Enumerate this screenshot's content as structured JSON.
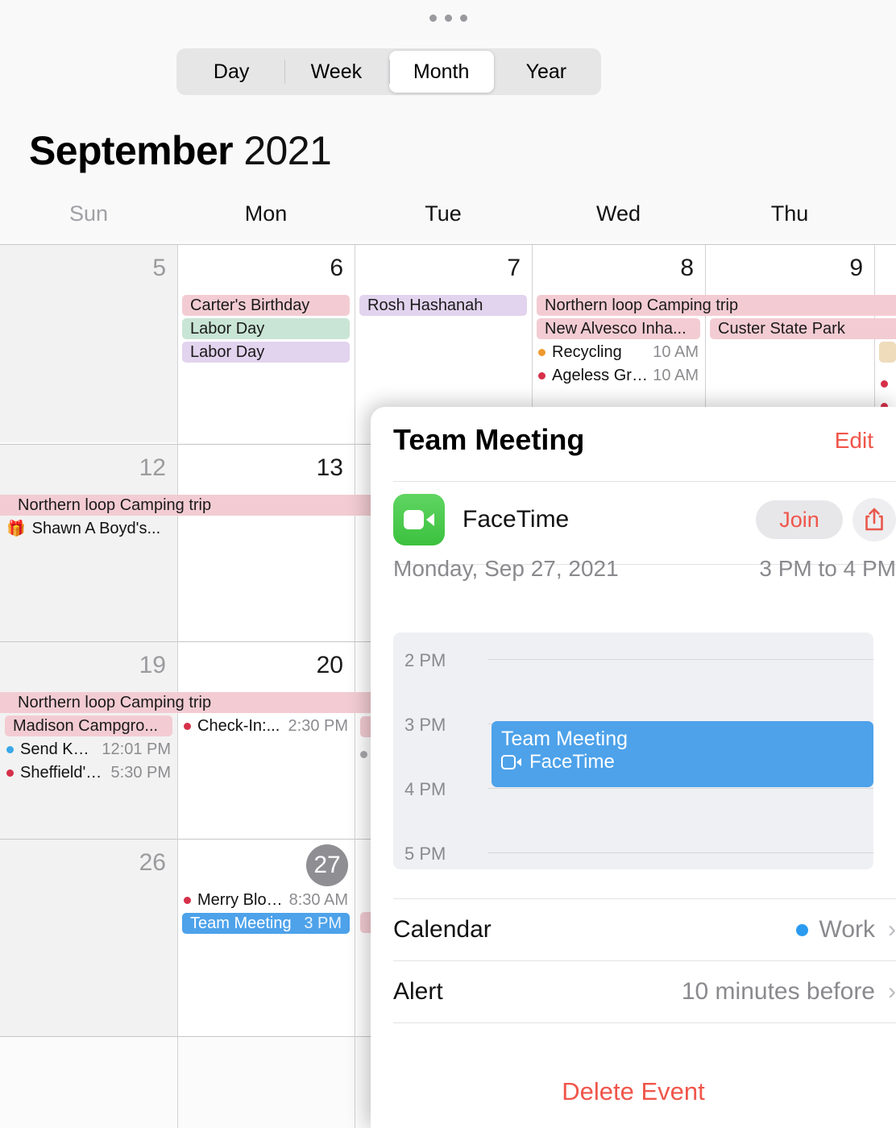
{
  "window": {
    "grabber": "multitasking-handle"
  },
  "view_switcher": {
    "options": [
      "Day",
      "Week",
      "Month",
      "Year"
    ],
    "selected": "Month"
  },
  "header": {
    "month": "September",
    "year": "2021"
  },
  "weekdays": [
    {
      "label": "Sun",
      "dim": true
    },
    {
      "label": "Mon",
      "dim": false
    },
    {
      "label": "Tue",
      "dim": false
    },
    {
      "label": "Wed",
      "dim": false
    },
    {
      "label": "Thu",
      "dim": false
    }
  ],
  "grid": {
    "weeks": [
      {
        "days": [
          {
            "num": "5",
            "weekend": true,
            "today": false
          },
          {
            "num": "6",
            "weekend": false,
            "today": false
          },
          {
            "num": "7",
            "weekend": false,
            "today": false
          },
          {
            "num": "8",
            "weekend": false,
            "today": false
          },
          {
            "num": "9",
            "weekend": false,
            "today": false
          }
        ],
        "events": [
          {
            "title": "Carter's Birthday",
            "color": "pink",
            "day": 1,
            "slot": 0
          },
          {
            "title": "Labor Day",
            "color": "green",
            "day": 1,
            "slot": 1
          },
          {
            "title": "Labor Day",
            "color": "purple",
            "day": 1,
            "slot": 2
          },
          {
            "title": "Rosh Hashanah",
            "color": "purple",
            "day": 2,
            "slot": 0
          },
          {
            "title": "Northern loop Camping trip",
            "color": "pink",
            "day": 3,
            "slot": 0,
            "span": true
          },
          {
            "title": "New Alvesco Inha...",
            "color": "pink",
            "day": 3,
            "slot": 1
          },
          {
            "title": "Custer State Park",
            "color": "pink",
            "day": 4,
            "slot": 1,
            "span": true
          }
        ],
        "timed": [
          {
            "title": "Recycling",
            "time": "10 AM",
            "dot": "#f09a2c",
            "day": 3,
            "slot": 2
          },
          {
            "title": "Ageless Grace",
            "time": "10 AM",
            "dot": "#d6304a",
            "day": 3,
            "slot": 3
          }
        ]
      },
      {
        "days": [
          {
            "num": "12",
            "weekend": true,
            "today": false
          },
          {
            "num": "13",
            "weekend": false,
            "today": false
          }
        ],
        "events": [
          {
            "title": "Northern loop Camping trip",
            "color": "pink",
            "day": 0,
            "slot": 0,
            "fullspan": true
          }
        ],
        "timed": [
          {
            "title": "Shawn A Boyd's...",
            "time": "",
            "gift": true,
            "day": 0,
            "slot": 1
          }
        ]
      },
      {
        "days": [
          {
            "num": "19",
            "weekend": true,
            "today": false
          },
          {
            "num": "20",
            "weekend": false,
            "today": false
          }
        ],
        "events": [
          {
            "title": "Northern loop Camping trip",
            "color": "pink",
            "day": 0,
            "slot": 0,
            "fullspan": true
          },
          {
            "title": "Madison Campgro...",
            "color": "pink",
            "day": 0,
            "slot": 1
          }
        ],
        "timed": [
          {
            "title": "Send Ken...",
            "time": "12:01 PM",
            "dot": "#3aa8e8",
            "day": 0,
            "slot": 2
          },
          {
            "title": "Sheffield's...",
            "time": "5:30 PM",
            "dot": "#d6304a",
            "day": 0,
            "slot": 3
          },
          {
            "title": "Check-In:...",
            "time": "2:30 PM",
            "dot": "#d6304a",
            "day": 1,
            "slot": 1
          }
        ]
      },
      {
        "days": [
          {
            "num": "26",
            "weekend": true,
            "today": false
          },
          {
            "num": "27",
            "weekend": false,
            "today": true
          }
        ],
        "events": [
          {
            "title": "Team Meeting",
            "time": "3 PM",
            "color": "blue",
            "day": 1,
            "slot": 1
          }
        ],
        "timed": [
          {
            "title": "Merry Bloo...",
            "time": "8:30 AM",
            "dot": "#d6304a",
            "day": 1,
            "slot": 0
          }
        ]
      }
    ]
  },
  "popover": {
    "title": "Team Meeting",
    "edit_label": "Edit",
    "facetime": {
      "label": "FaceTime",
      "join_label": "Join",
      "icon": "facetime-video-icon",
      "share_icon": "share-icon"
    },
    "date": "Monday, Sep 27, 2021",
    "time_range": "3 PM to 4 PM",
    "timeline": {
      "hours": [
        "2 PM",
        "3 PM",
        "4 PM",
        "5 PM"
      ],
      "event_title": "Team Meeting",
      "event_subtitle": "FaceTime",
      "event_start": "3 PM",
      "event_end": "4 PM"
    },
    "rows": [
      {
        "key": "Calendar",
        "value": "Work",
        "color": "#2a9bf0",
        "has_dot": true
      },
      {
        "key": "Alert",
        "value": "10 minutes before",
        "has_dot": false
      }
    ],
    "delete_label": "Delete Event"
  },
  "colors": {
    "accent_red": "#f0554a",
    "event_blue": "#4da2ea",
    "pink": "#f3ccd3",
    "green": "#c9e5d5",
    "purple": "#e2d3ee",
    "tan": "#eedcbb"
  }
}
